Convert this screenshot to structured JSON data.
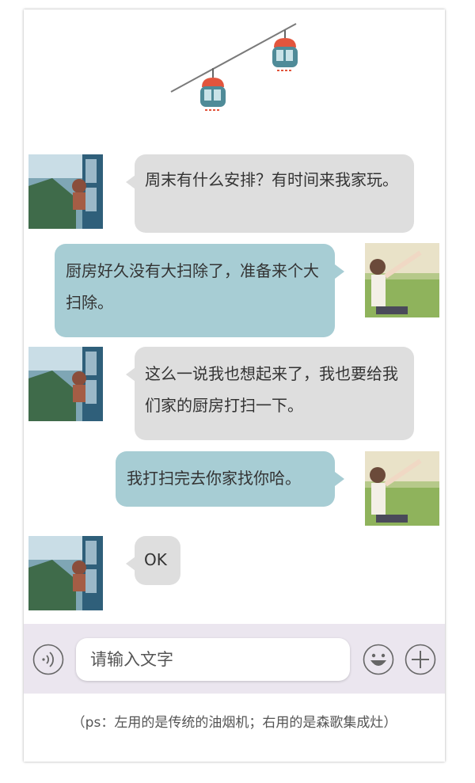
{
  "colors": {
    "bubble_left": "#dedede",
    "bubble_right": "#a7cdd4",
    "input_bar": "#ebe6ef",
    "cablecar_red": "#e2553d",
    "cablecar_teal": "#4f8b98"
  },
  "header": {
    "icon": "cable-car-icon"
  },
  "messages": [
    {
      "side": "left",
      "text": "周末有什么安排？有时间来我家玩。"
    },
    {
      "side": "right",
      "text": "厨房好久没有大扫除了，准备来个大扫除。"
    },
    {
      "side": "left",
      "text": "这么一说我也想起来了，我也要给我们家的厨房打扫一下。"
    },
    {
      "side": "right",
      "text": "我打扫完去你家找你哈。"
    },
    {
      "side": "left",
      "text": "OK"
    }
  ],
  "input": {
    "placeholder": "请输入文字",
    "voice_icon": "voice-icon",
    "emoji_icon": "emoji-icon",
    "plus_icon": "plus-icon"
  },
  "caption": "（ps：左用的是传统的油烟机；右用的是森歌集成灶）"
}
